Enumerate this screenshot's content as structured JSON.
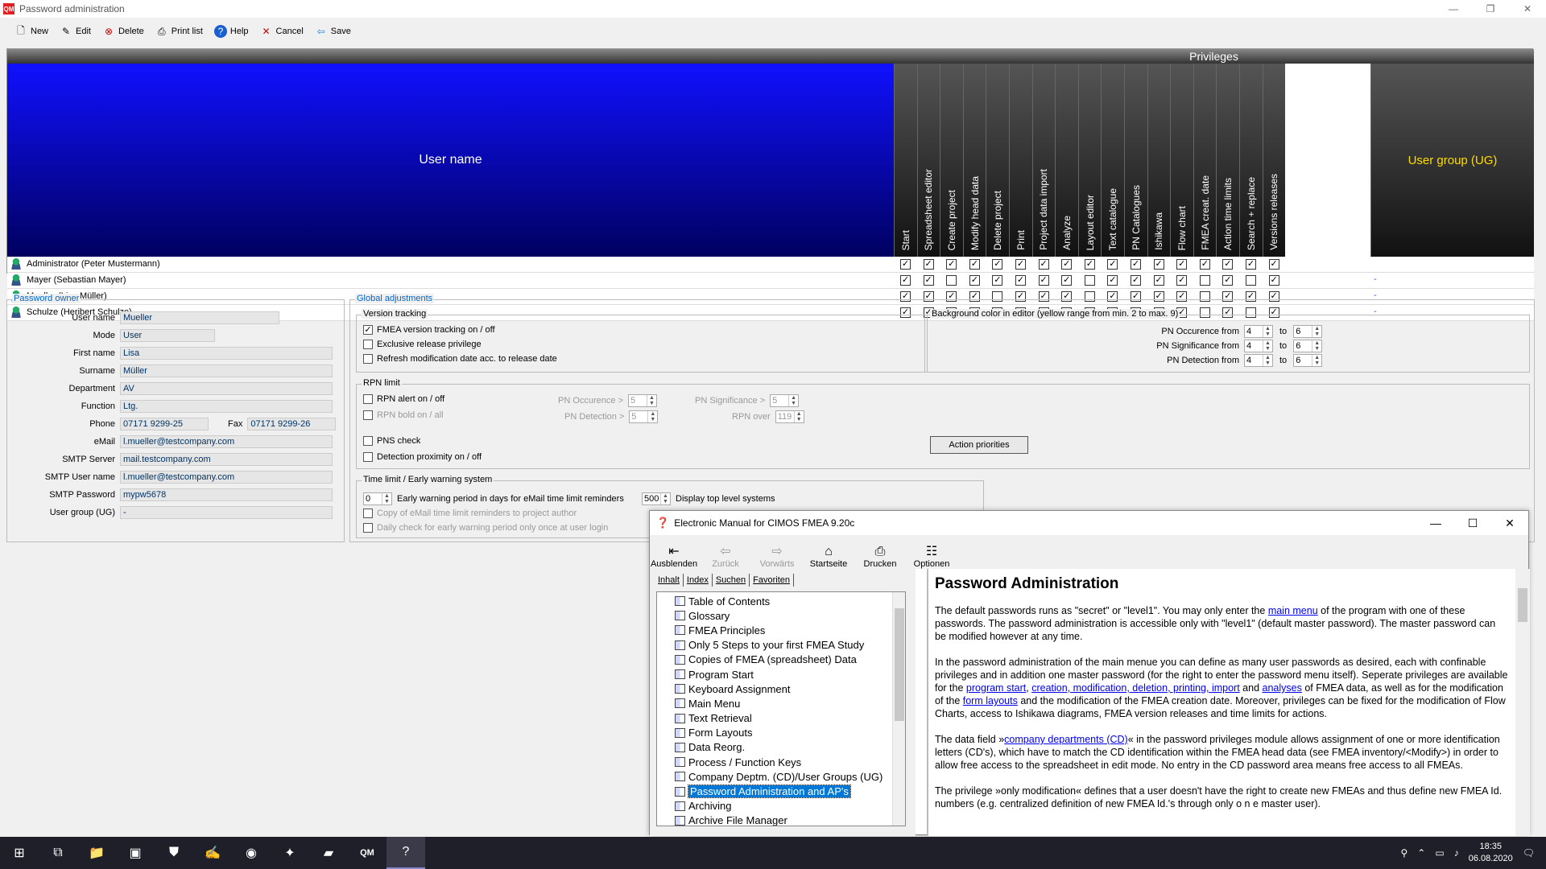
{
  "window": {
    "title": "Password administration",
    "logo": "QM",
    "controls": [
      "—",
      "❐",
      "✕"
    ]
  },
  "toolbar": [
    {
      "label": "New",
      "icon": "new-document-icon",
      "glyph": "🗋"
    },
    {
      "label": "Edit",
      "icon": "edit-icon",
      "glyph": "✎"
    },
    {
      "label": "Delete",
      "icon": "delete-icon",
      "glyph": "⊗"
    },
    {
      "label": "Print list",
      "icon": "printer-icon",
      "glyph": "⎙"
    },
    {
      "label": "Help",
      "icon": "help-icon",
      "glyph": "?"
    },
    {
      "label": "Cancel",
      "icon": "cancel-icon",
      "glyph": "✕"
    },
    {
      "label": "Save",
      "icon": "save-arrow-icon",
      "glyph": "⇦"
    }
  ],
  "grid": {
    "user_header": "User name",
    "privileges_header": "Privileges",
    "user_group_header": "User group (UG)",
    "columns": [
      "Start",
      "Spreadsheet editor",
      "Create project",
      "Modify head data",
      "Delete project",
      "Print",
      "Project data import",
      "Analyze",
      "Layout editor",
      "Text catalogue",
      "PN Catalogues",
      "Ishikawa",
      "Flow chart",
      "FMEA creat. date",
      "Action time limits",
      "Search + replace",
      "Versions releases"
    ],
    "rows": [
      {
        "name": "Administrator  (Peter Mustermann)",
        "checks": [
          1,
          1,
          1,
          1,
          1,
          1,
          1,
          1,
          1,
          1,
          1,
          1,
          1,
          1,
          1,
          1,
          1
        ],
        "ug": ""
      },
      {
        "name": "Mayer  (Sebastian Mayer)",
        "checks": [
          1,
          1,
          0,
          1,
          1,
          1,
          1,
          1,
          0,
          1,
          1,
          1,
          1,
          0,
          1,
          0,
          1
        ],
        "ug": "-"
      },
      {
        "name": "Mueller  (Lisa Müller)",
        "checks": [
          1,
          1,
          1,
          1,
          0,
          1,
          1,
          1,
          0,
          1,
          1,
          1,
          1,
          0,
          1,
          1,
          1
        ],
        "ug": "-"
      },
      {
        "name": "Schulze  (Heribert Schulze)",
        "checks": [
          1,
          1,
          1,
          1,
          0,
          0,
          1,
          1,
          1,
          1,
          0,
          1,
          1,
          0,
          1,
          0,
          1
        ],
        "ug": "-"
      }
    ]
  },
  "owner": {
    "legend": "Password owner",
    "fields": [
      {
        "label": "User name",
        "value": "Mueller"
      },
      {
        "label": "Mode",
        "value": "User"
      },
      {
        "label": "First name",
        "value": "Lisa"
      },
      {
        "label": "Surname",
        "value": "Müller"
      },
      {
        "label": "Department",
        "value": "AV"
      },
      {
        "label": "Function",
        "value": "Ltg."
      },
      {
        "label": "Phone",
        "value": "07171 9299-25"
      },
      {
        "label": "eMail",
        "value": "l.mueller@testcompany.com"
      },
      {
        "label": "SMTP Server",
        "value": "mail.testcompany.com"
      },
      {
        "label": "SMTP User name",
        "value": "l.mueller@testcompany.com"
      },
      {
        "label": "SMTP Password",
        "value": "mypw5678"
      },
      {
        "label": "User group (UG)",
        "value": "-"
      }
    ],
    "fax_label": "Fax",
    "fax_value": "07171 9299-26"
  },
  "global": {
    "legend": "Global adjustments",
    "version": {
      "legend": "Version tracking",
      "items": [
        {
          "label": "FMEA version tracking on / off",
          "checked": true
        },
        {
          "label": "Exclusive release privilege",
          "checked": false
        },
        {
          "label": "Refresh modification date acc. to release date",
          "checked": false
        }
      ]
    },
    "bg": {
      "legend": "Background color in editor (yellow range from min. 2 to max. 9)",
      "rows": [
        {
          "label": "PN Occurence from",
          "from": "4",
          "to": "6"
        },
        {
          "label": "PN Significance from",
          "from": "4",
          "to": "6"
        },
        {
          "label": "PN Detection from",
          "from": "4",
          "to": "6"
        }
      ],
      "to_label": "to"
    },
    "rpn": {
      "legend": "RPN  limit",
      "alert": "RPN  alert on / off",
      "bold": "RPN  bold on / all",
      "occ_label": "PN Occurence >",
      "occ": "5",
      "sig_label": "PN Significance >",
      "sig": "5",
      "det_label": "PN Detection >",
      "det": "5",
      "over_label": "RPN over",
      "over": "119",
      "pns": "PNS check",
      "prox": "Detection proximity on / off",
      "action_btn": "Action priorities"
    },
    "time": {
      "legend": "Time limit / Early warning system",
      "days": "0",
      "days_label": "Early warning period in days for eMail time limit reminders",
      "top": "500",
      "top_label": "Display top level systems",
      "copy": "Copy of eMail time limit reminders to project author",
      "daily": "Daily check for early warning period only once at user login"
    }
  },
  "help": {
    "title": "Electronic Manual for CIMOS FMEA 9.20c",
    "toolbar": [
      {
        "label": "Ausblenden",
        "glyph": "⇤",
        "icon": "hide-icon"
      },
      {
        "label": "Zurück",
        "glyph": "⇦",
        "icon": "back-arrow-icon"
      },
      {
        "label": "Vorwärts",
        "glyph": "⇨",
        "icon": "forward-arrow-icon"
      },
      {
        "label": "Startseite",
        "glyph": "⌂",
        "icon": "home-icon"
      },
      {
        "label": "Drucken",
        "glyph": "⎙",
        "icon": "printer-icon"
      },
      {
        "label": "Optionen",
        "glyph": "☷",
        "icon": "options-icon"
      }
    ],
    "tabs": [
      "Inhalt",
      "Index",
      "Suchen",
      "Favoriten"
    ],
    "toc": [
      "Table of Contents",
      "Glossary",
      "FMEA Principles",
      "Only 5 Steps to your first FMEA Study",
      "Copies of FMEA (spreadsheet) Data",
      "Program Start",
      "Keyboard Assignment",
      "Main Menu",
      "Text Retrieval",
      "Form Layouts",
      "Data Reorg.",
      "Process / Function Keys",
      "Company Deptm. (CD)/User Groups (UG)",
      "Password Administration and AP's",
      "Archiving",
      "Archive File Manager"
    ],
    "selected": 13,
    "heading": "Password Administration",
    "p1a": "The default passwords runs as \"secret\" or \"level1\". You may only enter the ",
    "p1link": "main menu",
    "p1b": " of the program with one of these passwords. The password administration is accessible only with \"level1\" (default master password). The master password can be modified however at any time.",
    "p2a": "In the password administration of the main menue you can define as many user passwords as desired, each with confinable privileges and in addition one master password (for the right to enter the password menu itself). Seperate privileges are available for the ",
    "p2l1": "program start",
    "p2c": ", ",
    "p2l2": "creation, modification, deletion, printing, import",
    "p2d": " and ",
    "p2l3": "analyses",
    "p2e": " of FMEA data, as well as for the modification of the ",
    "p2l4": "form layouts",
    "p2f": " and the modification of the FMEA creation date. Moreover, privileges can be fixed for the modification of Flow Charts, access to Ishikawa diagrams, FMEA version releases and time limits for actions.",
    "p3a": "The data field »",
    "p3link": "company departments (CD)",
    "p3b": "« in the password privileges module allows assignment of one or more identification letters (CD's), which have to match the CD identification within the FMEA head data (see FMEA inventory/<Modify>) in order to allow free access to the spreadsheet in edit mode. No entry in the CD password area means free access to all FMEAs.",
    "p4": "The privilege »only modification« defines that a user doesn't have the right to create new FMEAs and thus define new FMEA Id. numbers (e.g. centralized definition of new FMEA Id.'s through only  o n e  master user)."
  },
  "taskbar": {
    "time": "18:35",
    "date": "06.08.2020",
    "apps": [
      {
        "glyph": "⊞",
        "icon": "windows-start-icon"
      },
      {
        "glyph": "⧉",
        "icon": "task-view-icon"
      },
      {
        "glyph": "📁",
        "icon": "file-explorer-icon"
      },
      {
        "glyph": "▣",
        "icon": "app-icon"
      },
      {
        "glyph": "⛊",
        "icon": "shield-app-icon"
      },
      {
        "glyph": "✍",
        "icon": "acrobat-icon"
      },
      {
        "glyph": "◉",
        "icon": "firefox-icon"
      },
      {
        "glyph": "✦",
        "icon": "app-icon"
      },
      {
        "glyph": "▰",
        "icon": "app-icon"
      },
      {
        "glyph": "QM",
        "icon": "qm-app-icon"
      },
      {
        "glyph": "?",
        "icon": "help-app-icon"
      }
    ],
    "tray": [
      "⚲",
      "⌃",
      "▭",
      "♪"
    ]
  }
}
